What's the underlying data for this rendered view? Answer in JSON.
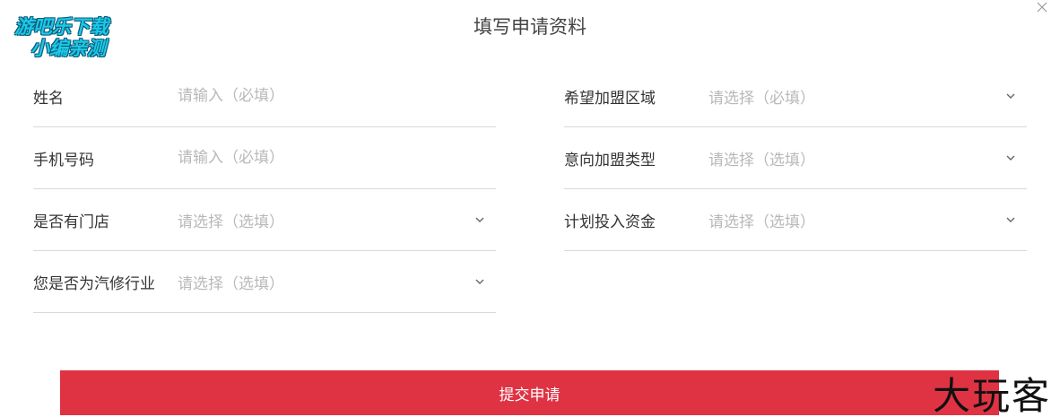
{
  "logo": {
    "line1": "游吧乐下载",
    "line2": "小编亲测"
  },
  "title": "填写申请资料",
  "left_fields": [
    {
      "label": "姓名",
      "placeholder": "请输入（必填）",
      "type": "input"
    },
    {
      "label": "手机号码",
      "placeholder": "请输入（必填）",
      "type": "input"
    },
    {
      "label": "是否有门店",
      "placeholder": "请选择（选填）",
      "type": "select"
    },
    {
      "label": "您是否为汽修行业",
      "placeholder": "请选择（选填）",
      "type": "select"
    }
  ],
  "right_fields": [
    {
      "label": "希望加盟区域",
      "placeholder": "请选择（必填）",
      "type": "select"
    },
    {
      "label": "意向加盟类型",
      "placeholder": "请选择（选填）",
      "type": "select"
    },
    {
      "label": "计划投入资金",
      "placeholder": "请选择（选填）",
      "type": "select"
    }
  ],
  "submit_label": "提交申请",
  "watermark": "大玩客",
  "icons": {
    "close": "close-icon",
    "dropdown": "chevron-down-icon"
  },
  "colors": {
    "accent": "#df3344",
    "logo": "#1bc9e6"
  }
}
